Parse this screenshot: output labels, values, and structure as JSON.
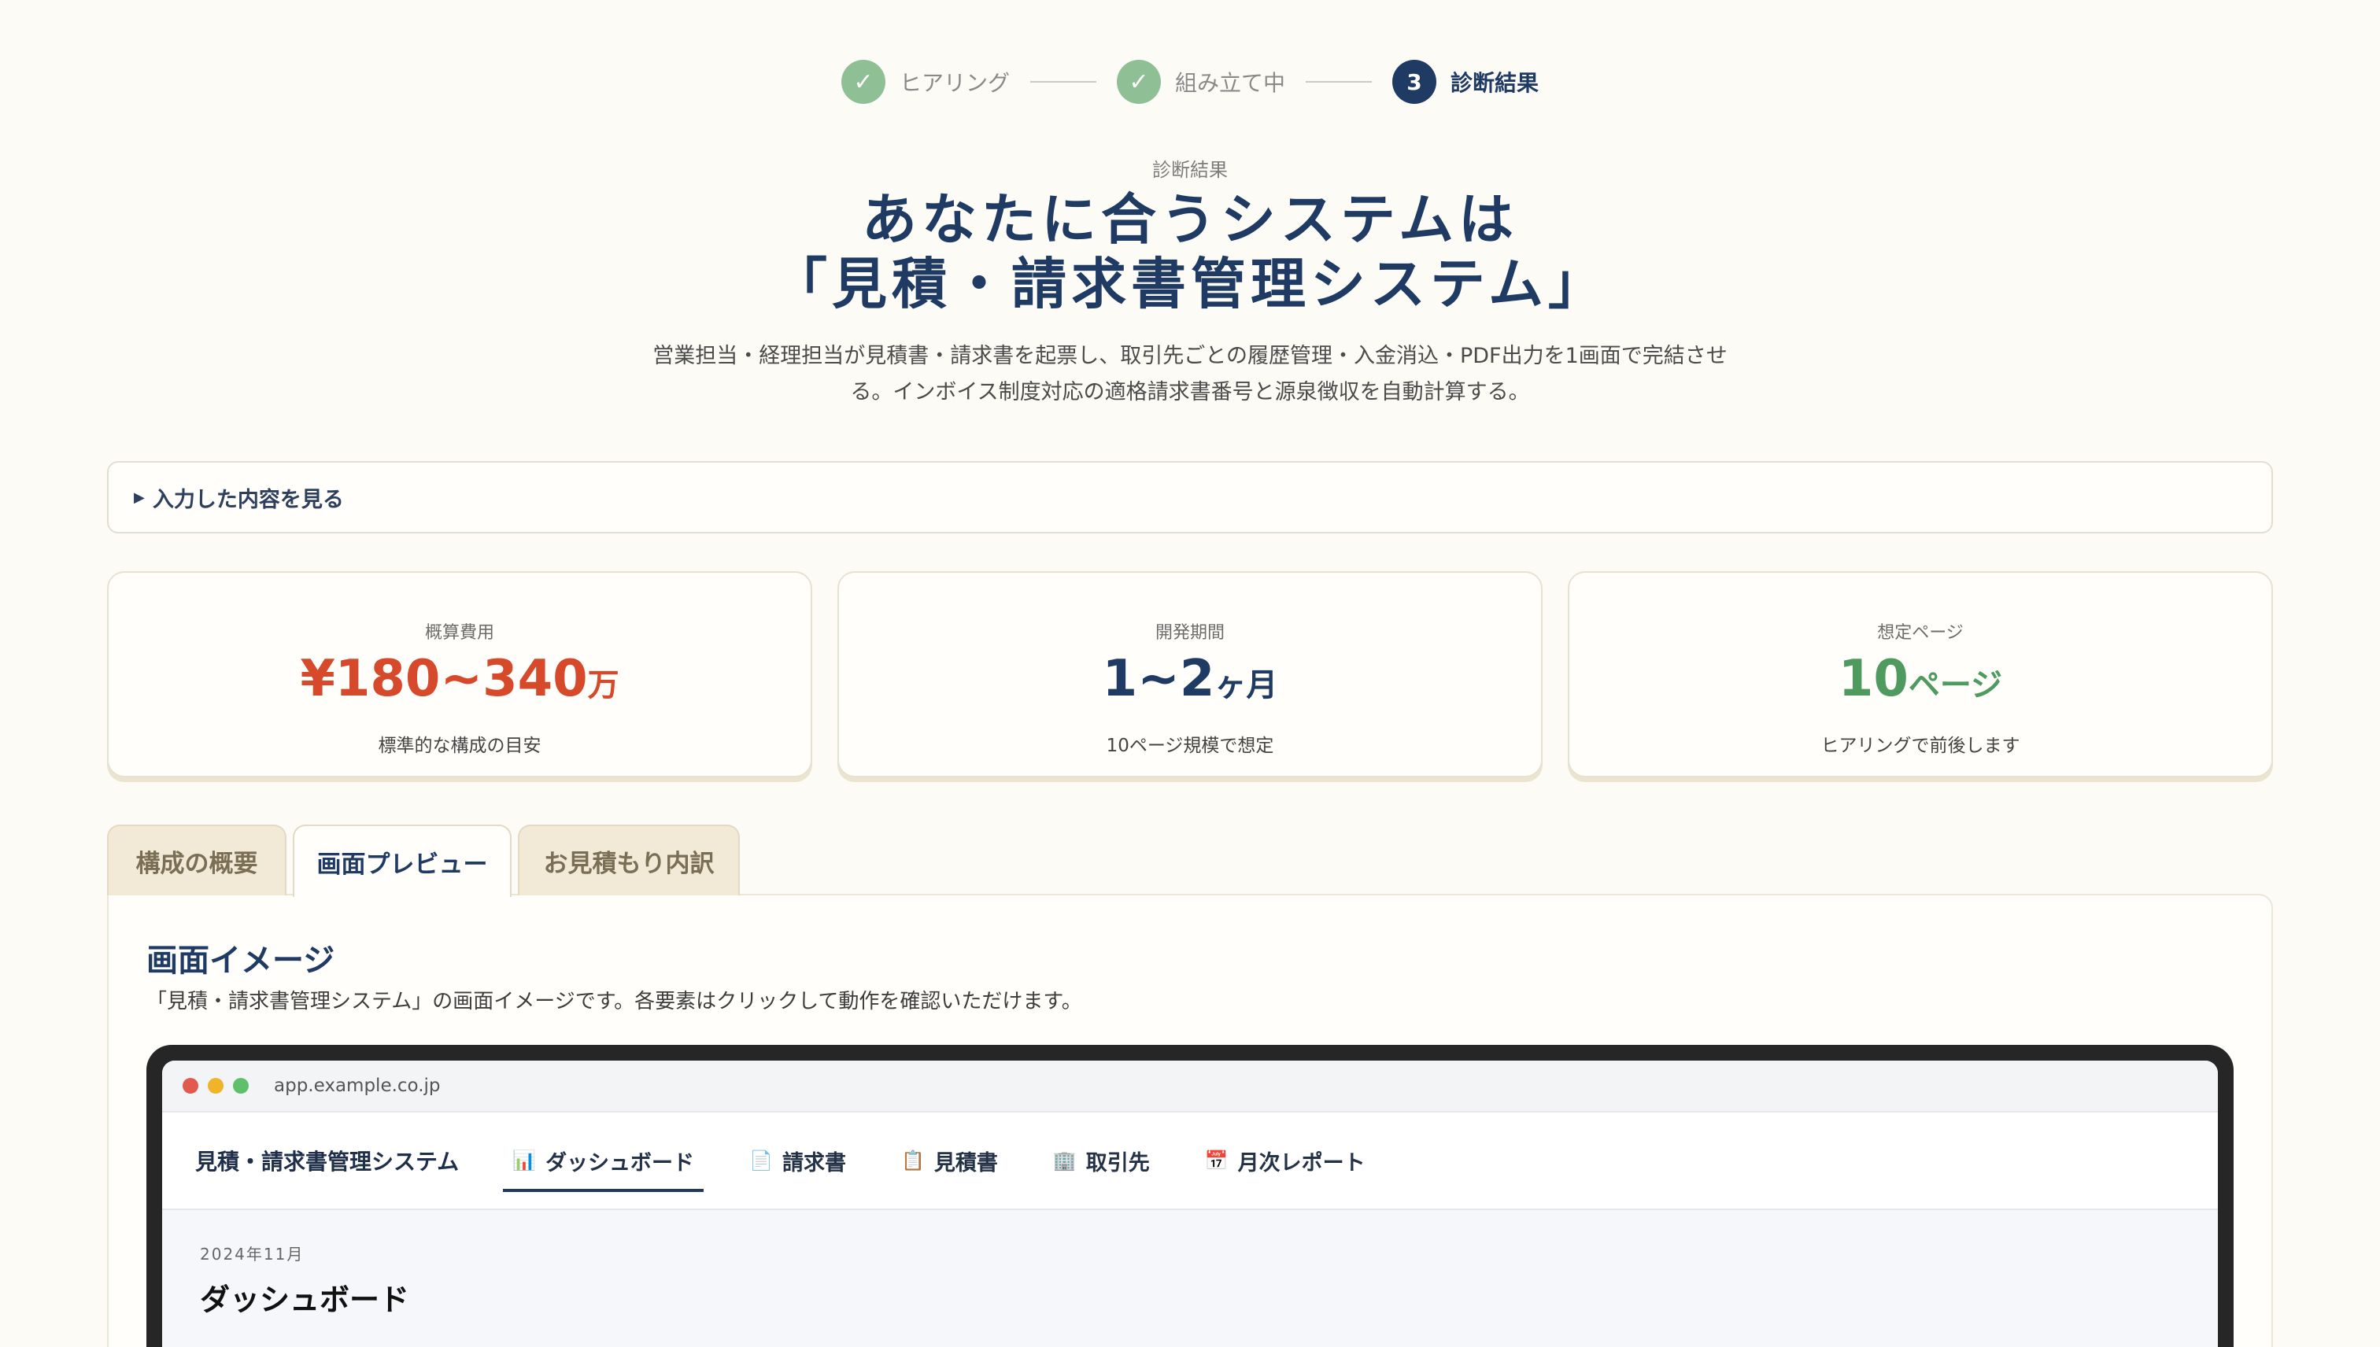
{
  "stepper": {
    "steps": [
      {
        "label": "ヒアリング",
        "state": "done",
        "marker": "✓"
      },
      {
        "label": "組み立て中",
        "state": "done",
        "marker": "✓"
      },
      {
        "label": "診断結果",
        "state": "active",
        "marker": "3"
      }
    ]
  },
  "hero": {
    "eyebrow": "診断結果",
    "title_line1": "あなたに合うシステムは",
    "title_line2": "「見積・請求書管理システム」",
    "description": "営業担当・経理担当が見積書・請求書を起票し、取引先ごとの履歴管理・入金消込・PDF出力を1画面で完結させる。インボイス制度対応の適格請求書番号と源泉徴収を自動計算する。"
  },
  "details_toggle": {
    "label": "入力した内容を見る",
    "icon": "triangle-right-icon"
  },
  "stats": [
    {
      "label": "概算費用",
      "value": "¥180~340",
      "unit": "万",
      "sub": "標準的な構成の目安",
      "color": "#d6492a"
    },
    {
      "label": "開発期間",
      "value": "1~2",
      "unit": "ヶ月",
      "sub": "10ページ規模で想定",
      "color": "#1f3a63"
    },
    {
      "label": "想定ページ",
      "value": "10",
      "unit": "ページ",
      "sub": "ヒアリングで前後します",
      "color": "#4f9a5e"
    }
  ],
  "tabs": [
    {
      "label": "構成の概要",
      "active": false
    },
    {
      "label": "画面プレビュー",
      "active": true
    },
    {
      "label": "お見積もり内訳",
      "active": false
    }
  ],
  "panel": {
    "title": "画面イメージ",
    "description": "「見積・請求書管理システム」の画面イメージです。各要素はクリックして動作を確認いただけます。"
  },
  "preview": {
    "url": "app.example.co.jp",
    "app_name": "見積・請求書管理システム",
    "nav": [
      {
        "label": "ダッシュボード",
        "icon": "bar-chart-icon",
        "active": true
      },
      {
        "label": "請求書",
        "icon": "document-icon",
        "active": false
      },
      {
        "label": "見積書",
        "icon": "clipboard-icon",
        "active": false
      },
      {
        "label": "取引先",
        "icon": "building-icon",
        "active": false
      },
      {
        "label": "月次レポート",
        "icon": "calendar-icon",
        "active": false
      }
    ],
    "date": "2024年11月",
    "heading": "ダッシュボード"
  }
}
